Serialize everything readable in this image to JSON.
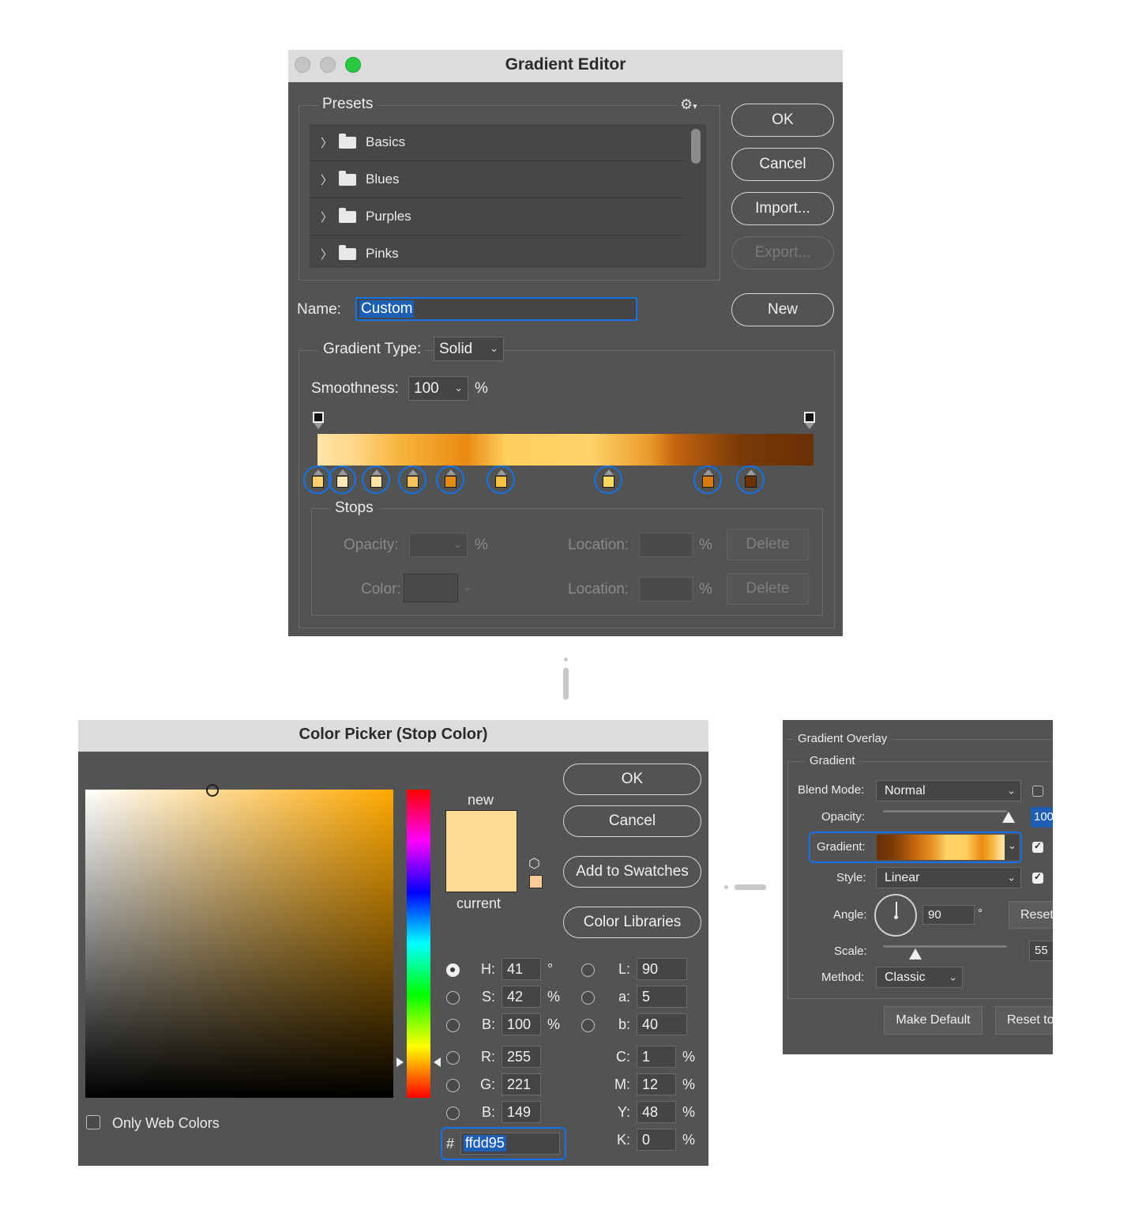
{
  "gradient_editor": {
    "title": "Gradient Editor",
    "presets": {
      "label": "Presets",
      "items": [
        "Basics",
        "Blues",
        "Purples",
        "Pinks"
      ]
    },
    "buttons": {
      "ok": "OK",
      "cancel": "Cancel",
      "import": "Import...",
      "export": "Export...",
      "new": "New"
    },
    "name_label": "Name:",
    "name_value": "Custom",
    "gradient_type_label": "Gradient Type:",
    "gradient_type_value": "Solid",
    "smoothness_label": "Smoothness:",
    "smoothness_value": "100",
    "smoothness_unit": "%",
    "gradient_colors": [
      "#ffe4a8",
      "#ffd88a",
      "#f6b33a",
      "#e98a12",
      "#ffcf5e",
      "#ffd36a",
      "#e99a2a",
      "#c4650e",
      "#7a3a08",
      "#6a3006"
    ],
    "stop_colors": [
      "#ffd06e",
      "#ffe9b8",
      "#ffe4a6",
      "#f6c35a",
      "#e38b13",
      "#f5c140",
      "#ffd95c",
      "#d97b0c",
      "#6b3206"
    ],
    "stops_group": {
      "label": "Stops",
      "opacity_label": "Opacity:",
      "color_label": "Color:",
      "location_label": "Location:",
      "percent": "%",
      "delete_label": "Delete"
    }
  },
  "color_picker": {
    "title": "Color Picker (Stop Color)",
    "new_label": "new",
    "current_label": "current",
    "new_color": "#ffdd95",
    "current_color": "#ffdd95",
    "buttons": {
      "ok": "OK",
      "cancel": "Cancel",
      "add_to_swatches": "Add to Swatches",
      "color_libraries": "Color Libraries"
    },
    "only_web_colors": "Only Web Colors",
    "hsb": [
      {
        "label": "H:",
        "value": "41",
        "unit": "°"
      },
      {
        "label": "S:",
        "value": "42",
        "unit": "%"
      },
      {
        "label": "B:",
        "value": "100",
        "unit": "%"
      }
    ],
    "rgb": [
      {
        "label": "R:",
        "value": "255"
      },
      {
        "label": "G:",
        "value": "221"
      },
      {
        "label": "B:",
        "value": "149"
      }
    ],
    "lab": [
      {
        "label": "L:",
        "value": "90"
      },
      {
        "label": "a:",
        "value": "5"
      },
      {
        "label": "b:",
        "value": "40"
      }
    ],
    "cmyk": [
      {
        "label": "C:",
        "value": "1",
        "unit": "%"
      },
      {
        "label": "M:",
        "value": "12",
        "unit": "%"
      },
      {
        "label": "Y:",
        "value": "48",
        "unit": "%"
      },
      {
        "label": "K:",
        "value": "0",
        "unit": "%"
      }
    ],
    "hex_symbol": "#",
    "hex_value": "ffdd95",
    "field_hue_color": "#ffa800"
  },
  "gradient_overlay": {
    "title": "Gradient Overlay",
    "group_label": "Gradient",
    "blend_mode_label": "Blend Mode:",
    "blend_mode_value": "Normal",
    "opacity_label": "Opacity:",
    "opacity_value": "100",
    "gradient_label": "Gradient:",
    "style_label": "Style:",
    "style_value": "Linear",
    "angle_label": "Angle:",
    "angle_value": "90",
    "angle_unit": "°",
    "reset_label": "Reset",
    "scale_label": "Scale:",
    "scale_value": "55",
    "method_label": "Method:",
    "method_value": "Classic",
    "make_default": "Make Default",
    "reset_to": "Reset to"
  },
  "colors": {
    "dialog_bg": "#535353",
    "titlebar": "#dcdcdc",
    "accent_blue": "#1473e6",
    "traffic_close": "#c8c8c8",
    "traffic_zoom": "#28c840"
  }
}
